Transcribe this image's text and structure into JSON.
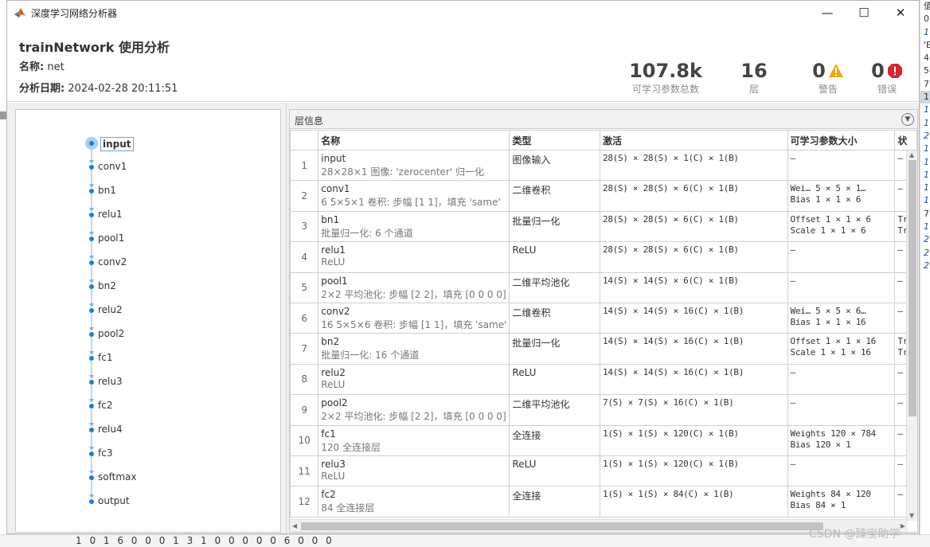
{
  "background": {
    "right_column": [
      "值",
      "0",
      "1",
      "'E",
      "4",
      "5",
      "7",
      "1",
      "1",
      "1",
      "2",
      "1",
      "1",
      "1",
      "1",
      "1",
      "7",
      "1",
      "2",
      "2",
      "2"
    ],
    "bottom_line": "1 0 1 6 0 0 0 1 3 1 0 0 0 0 0 6 0 0 0"
  },
  "window": {
    "title": "深度学习网络分析器",
    "controls": {
      "minimize": "—",
      "maximize": "☐",
      "close": "✕"
    }
  },
  "header": {
    "title": "trainNetwork 使用分析",
    "name_label": "名称:",
    "name_value": "net",
    "date_label": "分析日期:",
    "date_value": "2024-02-28 20:11:51",
    "stats": {
      "params": {
        "value": "107.8k",
        "label": "可学习参数总数"
      },
      "layers": {
        "value": "16",
        "label": "层"
      },
      "warnings": {
        "value": "0",
        "label": "警告"
      },
      "errors": {
        "value": "0",
        "label": "错误"
      }
    }
  },
  "graph": {
    "nodes": [
      "input",
      "conv1",
      "bn1",
      "relu1",
      "pool1",
      "conv2",
      "bn2",
      "relu2",
      "pool2",
      "fc1",
      "relu3",
      "fc2",
      "relu4",
      "fc3",
      "softmax",
      "output"
    ],
    "selected": "input"
  },
  "table": {
    "panel_title": "层信息",
    "headers": {
      "name": "名称",
      "type": "类型",
      "activation": "激活",
      "params": "可学习参数大小",
      "state": "状"
    },
    "rows": [
      {
        "idx": "1",
        "name": "input",
        "desc": "28×28×1 图像: 'zerocenter' 归一化",
        "type": "图像输入",
        "act": "28(S) × 28(S) × 1(C) × 1(B)",
        "p1": "–",
        "p2": "",
        "s1": "–",
        "s2": ""
      },
      {
        "idx": "2",
        "name": "conv1",
        "desc": "6 5×5×1 卷积: 步幅 [1 1]，填充 'same'",
        "type": "二维卷积",
        "act": "28(S) × 28(S) × 6(C) × 1(B)",
        "p1": "Wei…   5 × 5 × 1…",
        "p2": "Bias   1 × 1 × 6",
        "s1": "–",
        "s2": ""
      },
      {
        "idx": "3",
        "name": "bn1",
        "desc": "批量归一化: 6 个通道",
        "type": "批量归一化",
        "act": "28(S) × 28(S) × 6(C) × 1(B)",
        "p1": "Offset  1 × 1 × 6",
        "p2": "Scale   1 × 1 × 6",
        "s1": "Tr",
        "s2": "Tr"
      },
      {
        "idx": "4",
        "name": "relu1",
        "desc": "ReLU",
        "type": "ReLU",
        "act": "28(S) × 28(S) × 6(C) × 1(B)",
        "p1": "–",
        "p2": "",
        "s1": "–",
        "s2": ""
      },
      {
        "idx": "5",
        "name": "pool1",
        "desc": "2×2 平均池化: 步幅 [2 2]，填充 [0 0 0 0]",
        "type": "二维平均池化",
        "act": "14(S) × 14(S) × 6(C) × 1(B)",
        "p1": "–",
        "p2": "",
        "s1": "–",
        "s2": ""
      },
      {
        "idx": "6",
        "name": "conv2",
        "desc": "16 5×5×6 卷积: 步幅 [1 1]，填充 'same'",
        "type": "二维卷积",
        "act": "14(S) × 14(S) × 16(C) × 1(B)",
        "p1": "Wei…   5 × 5 × 6…",
        "p2": "Bias   1 × 1 × 16",
        "s1": "–",
        "s2": ""
      },
      {
        "idx": "7",
        "name": "bn2",
        "desc": "批量归一化: 16 个通道",
        "type": "批量归一化",
        "act": "14(S) × 14(S) × 16(C) × 1(B)",
        "p1": "Offset  1 × 1 × 16",
        "p2": "Scale   1 × 1 × 16",
        "s1": "Tr",
        "s2": "Tr"
      },
      {
        "idx": "8",
        "name": "relu2",
        "desc": "ReLU",
        "type": "ReLU",
        "act": "14(S) × 14(S) × 16(C) × 1(B)",
        "p1": "–",
        "p2": "",
        "s1": "–",
        "s2": ""
      },
      {
        "idx": "9",
        "name": "pool2",
        "desc": "2×2 平均池化: 步幅 [2 2]，填充 [0 0 0 0]",
        "type": "二维平均池化",
        "act": "7(S) × 7(S) × 16(C) × 1(B)",
        "p1": "–",
        "p2": "",
        "s1": "–",
        "s2": ""
      },
      {
        "idx": "10",
        "name": "fc1",
        "desc": "120 全连接层",
        "type": "全连接",
        "act": "1(S) × 1(S) × 120(C) × 1(B)",
        "p1": "Weights  120 × 784",
        "p2": "Bias     120 × 1",
        "s1": "–",
        "s2": ""
      },
      {
        "idx": "11",
        "name": "relu3",
        "desc": "ReLU",
        "type": "ReLU",
        "act": "1(S) × 1(S) × 120(C) × 1(B)",
        "p1": "–",
        "p2": "",
        "s1": "–",
        "s2": ""
      },
      {
        "idx": "12",
        "name": "fc2",
        "desc": "84 全连接层",
        "type": "全连接",
        "act": "1(S) × 1(S) × 84(C) × 1(B)",
        "p1": "Weights  84 × 120",
        "p2": "Bias     84 × 1",
        "s1": "–",
        "s2": ""
      }
    ]
  },
  "watermark": "CSDN @臻宝助学",
  "colors": {
    "accent": "#1b7fd1",
    "warning": "#f2a900",
    "error": "#d9272e",
    "node": "#1b7fd1"
  }
}
